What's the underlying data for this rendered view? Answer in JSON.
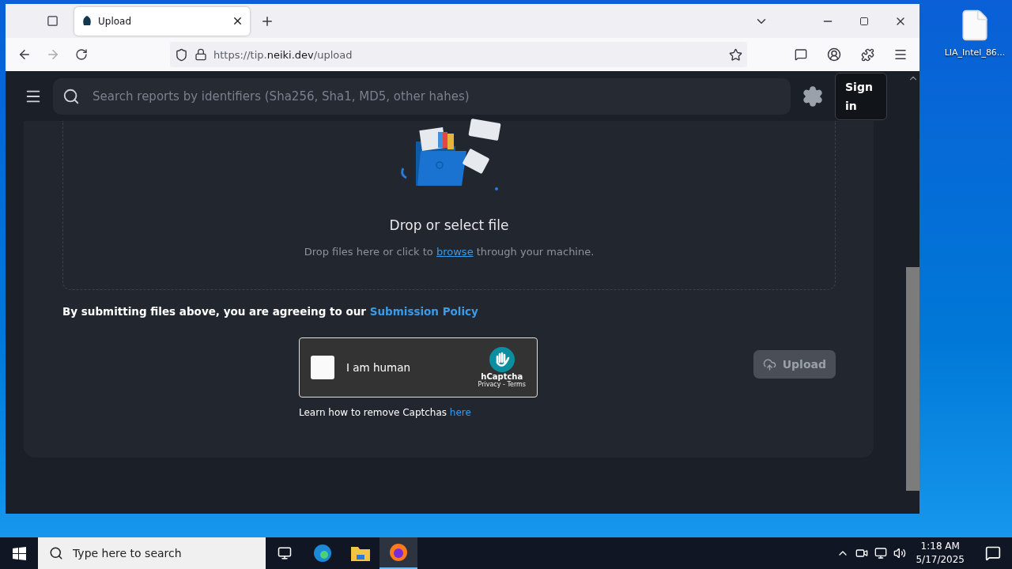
{
  "browser": {
    "tab": {
      "title": "Upload",
      "selected": true
    },
    "url": {
      "prefix": "https://tip.",
      "domain": "neiki.dev",
      "path": "/upload"
    }
  },
  "header": {
    "search_placeholder": "Search reports by identifiers (Sha256, Sha1, MD5, other hahes)",
    "sign_in": "Sign in"
  },
  "dropzone": {
    "title": "Drop or select file",
    "hint_before": "Drop files here or click to ",
    "hint_link": "browse",
    "hint_after": " through your machine."
  },
  "policy": {
    "text": "By submitting files above, you are agreeing to our ",
    "link": "Submission Policy"
  },
  "captcha": {
    "label": "I am human",
    "checked": false,
    "brand": "hCaptcha",
    "links": "Privacy - Terms"
  },
  "captcha_help": {
    "text": "Learn how to remove Captchas ",
    "link": "here"
  },
  "upload_button": {
    "label": "Upload",
    "disabled": true
  },
  "desktop": {
    "icons": [
      {
        "label": "LIA_Intel_86..."
      }
    ]
  },
  "taskbar": {
    "search_placeholder": "Type here to search",
    "time": "1:18 AM",
    "date": "5/17/2025"
  }
}
